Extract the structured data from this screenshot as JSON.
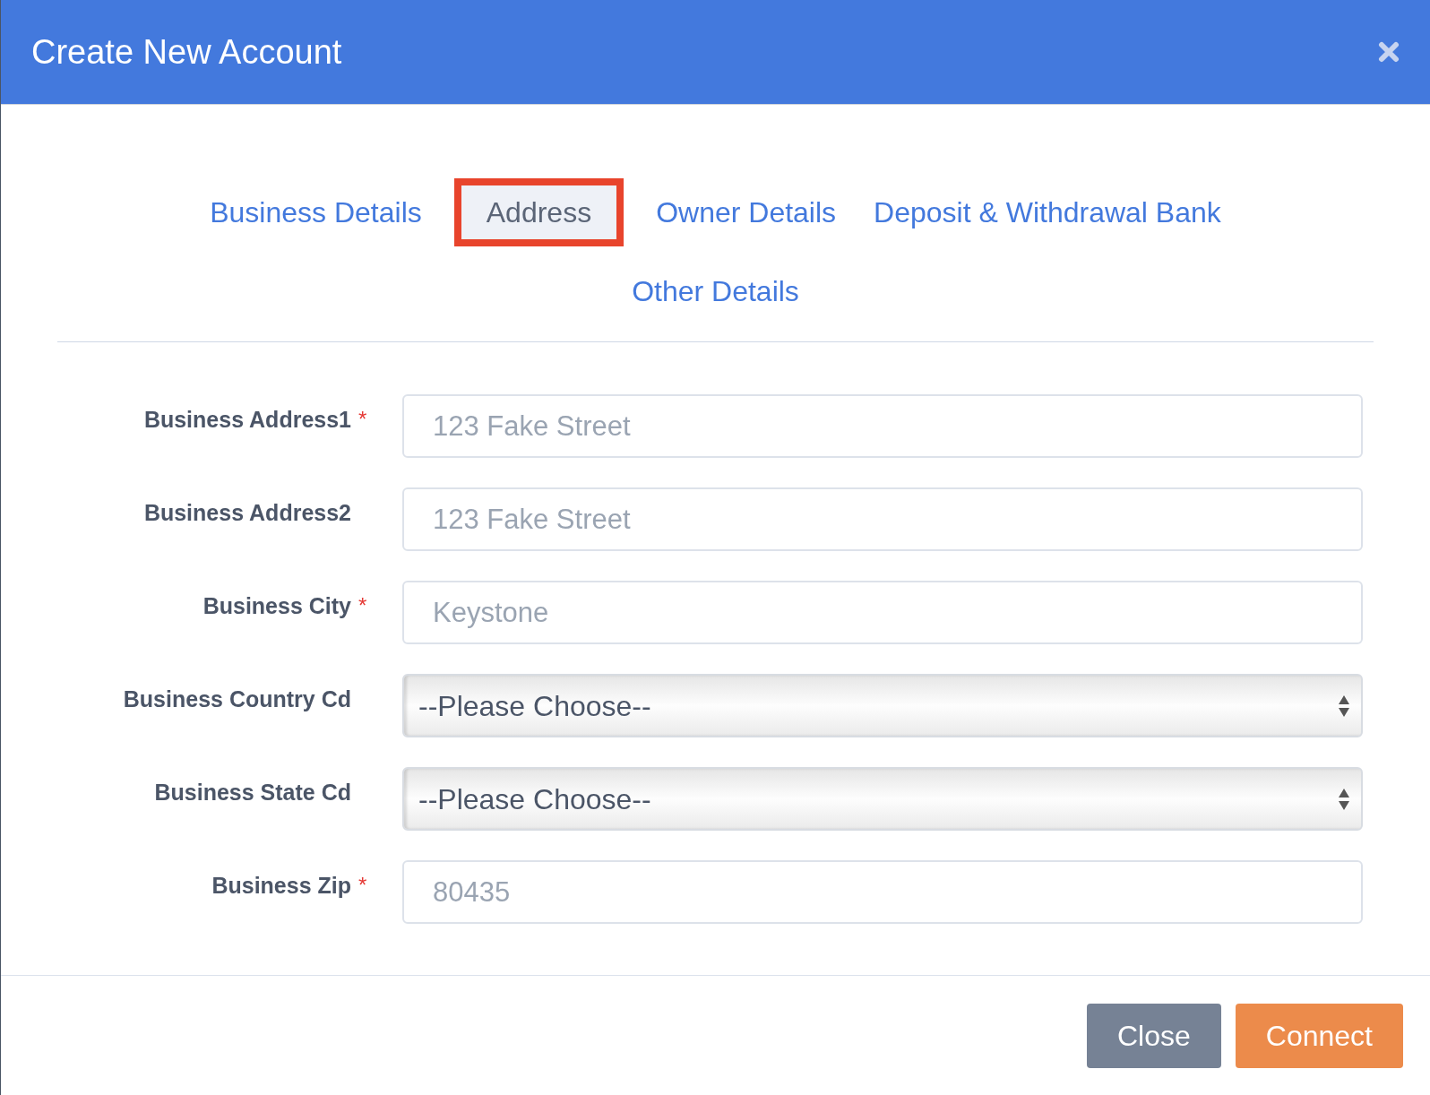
{
  "window": {
    "title": "Create New Account"
  },
  "tabs": [
    {
      "label": "Business Details",
      "selected": false
    },
    {
      "label": "Address",
      "selected": true
    },
    {
      "label": "Owner Details",
      "selected": false
    },
    {
      "label": "Deposit & Withdrawal Bank",
      "selected": false
    },
    {
      "label": "Other Details",
      "selected": false
    }
  ],
  "fields": [
    {
      "kind": "text",
      "label": "Business Address1",
      "required_mark": "*",
      "placeholder": "123 Fake Street"
    },
    {
      "kind": "text",
      "label": "Business Address2",
      "placeholder": "123 Fake Street"
    },
    {
      "kind": "text",
      "label": "Business City",
      "required_mark": "*",
      "placeholder": "Keystone"
    },
    {
      "kind": "select",
      "label": "Business Country Cd",
      "value": "--Please Choose--"
    },
    {
      "kind": "select",
      "label": "Business State Cd",
      "value": "--Please Choose--"
    },
    {
      "kind": "text",
      "label": "Business Zip",
      "required_mark": "*",
      "placeholder": "80435"
    }
  ],
  "buttons": [
    {
      "kind": "secondary",
      "label": "Close"
    },
    {
      "kind": "primary",
      "label": "Connect"
    }
  ]
}
